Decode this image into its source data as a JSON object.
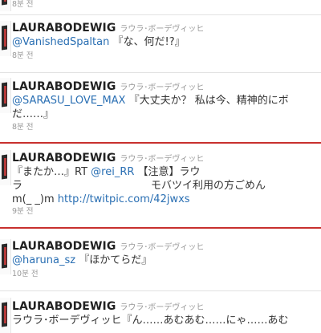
{
  "tweets": [
    {
      "screen_name": "",
      "full_name": "",
      "line1_pre": "",
      "line1_link": "",
      "line1_post": "",
      "line2_pre": "",
      "line2_link": "",
      "line2_post": "",
      "line3_pre": "",
      "line3_link": "",
      "line3_post": "",
      "timestamp": "8분 전"
    },
    {
      "screen_name": "LAURABODEWIG",
      "full_name": "ラウラ･ボーデヴィッヒ",
      "line1_pre": "",
      "line1_link": "@VanishedSpaltan",
      "line1_post": " 『な、何だ!?』",
      "line2_pre": "",
      "line2_link": "",
      "line2_post": "",
      "line3_pre": "",
      "line3_link": "",
      "line3_post": "",
      "timestamp": "8분 전"
    },
    {
      "screen_name": "LAURABODEWIG",
      "full_name": "ラウラ･ボーデヴィッヒ",
      "line1_pre": "",
      "line1_link": "@SARASU_LOVE_MAX",
      "line1_post": " 『大丈夫か？ 私は今、精神的にボ",
      "line2_pre": "だ……』",
      "line2_link": "",
      "line2_post": "",
      "line3_pre": "",
      "line3_link": "",
      "line3_post": "",
      "timestamp": "8분 전"
    },
    {
      "screen_name": "LAURABODEWIG",
      "full_name": "ラウラ･ボーデヴィッヒ",
      "line1_pre": "『またか…』RT ",
      "line1_link": "@rei_RR",
      "line1_post": " 【注意】ラウ",
      "line2_pre": "ラ",
      "line2_link": "",
      "line2_post": "モバツイ利用の方ごめん",
      "line3_pre": "m(_ _)m ",
      "line3_link": "http://twitpic.com/42jwxs",
      "line3_post": "",
      "timestamp": "9분 전"
    },
    {
      "screen_name": "LAURABODEWIG",
      "full_name": "ラウラ･ボーデヴィッヒ",
      "line1_pre": "",
      "line1_link": "@haruna_sz",
      "line1_post": " 『ほかてらだ』",
      "line2_pre": "",
      "line2_link": "",
      "line2_post": "",
      "line3_pre": "",
      "line3_link": "",
      "line3_post": "",
      "timestamp": "10분 전"
    },
    {
      "screen_name": "LAURABODEWIG",
      "full_name": "ラウラ･ボーデヴィッヒ",
      "line1_pre": "ラウラ･ボーデヴィッヒ『ん……あむあむ……にゃ……あむ",
      "line1_link": "",
      "line1_post": "",
      "line2_pre": "",
      "line2_link": "",
      "line2_post": "",
      "line3_pre": "",
      "line3_link": "",
      "line3_post": "",
      "timestamp": ""
    }
  ]
}
